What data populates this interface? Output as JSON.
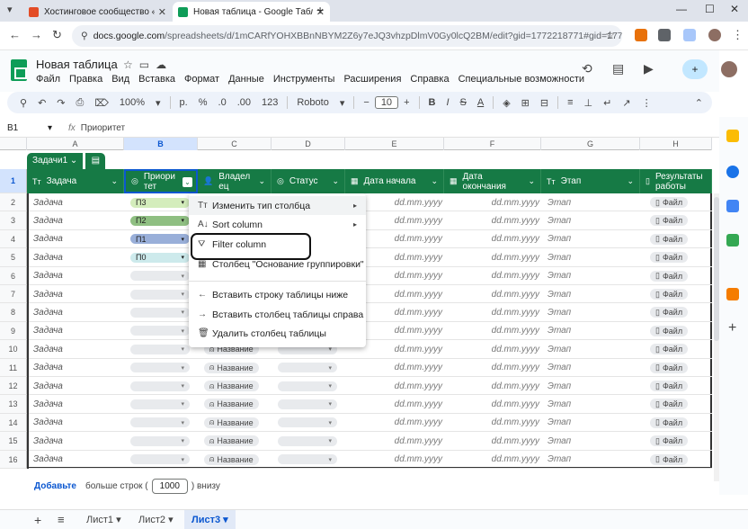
{
  "browser": {
    "tabs": [
      {
        "title": "Хостинговое сообщество «Tim",
        "active": false
      },
      {
        "title": "Новая таблица - Google Табли",
        "active": true
      }
    ],
    "url_host": "docs.google.com",
    "url_path": "/spreadsheets/d/1mCARfYOHXBBnNBYM2Z6y7eJQ3vhzpDlmV0Gy0lcQ2BM/edit?gid=1772218771#gid=1772218771"
  },
  "sheets": {
    "title": "Новая таблица",
    "menu": [
      "Файл",
      "Правка",
      "Вид",
      "Вставка",
      "Формат",
      "Данные",
      "Инструменты",
      "Расширения",
      "Справка",
      "Специальные возможности"
    ],
    "toolbar": {
      "zoom": "100%",
      "percent": "%",
      "decimals_less": ".0",
      "decimals_more": ".00",
      "format_123": "123",
      "font": "Roboto",
      "font_size": "10",
      "bold": "B",
      "italic": "I",
      "strike": "S",
      "text_color": "A"
    },
    "formula": {
      "cell": "B1",
      "value": "Приоритет"
    },
    "column_letters": [
      "A",
      "B",
      "C",
      "D",
      "E",
      "F",
      "G",
      "H"
    ],
    "table_name": "Задачи1",
    "headers": [
      {
        "icon": "Tт",
        "label": "Задача"
      },
      {
        "icon": "◎",
        "label": "Приори тет"
      },
      {
        "icon": "👤",
        "label": "Владел ец"
      },
      {
        "icon": "◎",
        "label": "Статус"
      },
      {
        "icon": "▦",
        "label": "Дата начала"
      },
      {
        "icon": "▦",
        "label": "Дата окончания"
      },
      {
        "icon": "Tт",
        "label": "Этап"
      },
      {
        "icon": "▯",
        "label": "Результаты работы"
      }
    ],
    "row_numbers": [
      "1",
      "2",
      "3",
      "4",
      "5",
      "6",
      "7",
      "8",
      "9",
      "10",
      "11",
      "12",
      "13",
      "14",
      "15",
      "16"
    ],
    "rows": [
      {
        "task": "Задача",
        "priority": "П3",
        "pcolor": "#d4edbc",
        "owner": "",
        "date_start": "dd.mm.yyyy",
        "date_end": "dd.mm.yyyy",
        "stage": "Этап",
        "file": "Файл"
      },
      {
        "task": "Задача",
        "priority": "П2",
        "pcolor": "#8fbf82",
        "owner": "",
        "date_start": "dd.mm.yyyy",
        "date_end": "dd.mm.yyyy",
        "stage": "Этап",
        "file": "Файл"
      },
      {
        "task": "Задача",
        "priority": "П1",
        "pcolor": "#99afd9",
        "owner": "",
        "date_start": "dd.mm.yyyy",
        "date_end": "dd.mm.yyyy",
        "stage": "Этап",
        "file": "Файл"
      },
      {
        "task": "Задача",
        "priority": "П0",
        "pcolor": "#cdeaec",
        "owner": "",
        "date_start": "dd.mm.yyyy",
        "date_end": "dd.mm.yyyy",
        "stage": "Этап",
        "file": "Файл"
      },
      {
        "task": "Задача",
        "priority": "",
        "pcolor": "",
        "owner": "",
        "date_start": "dd.mm.yyyy",
        "date_end": "dd.mm.yyyy",
        "stage": "Этап",
        "file": "Файл"
      },
      {
        "task": "Задача",
        "priority": "",
        "pcolor": "",
        "owner": "",
        "date_start": "dd.mm.yyyy",
        "date_end": "dd.mm.yyyy",
        "stage": "Этап",
        "file": "Файл"
      },
      {
        "task": "Задача",
        "priority": "",
        "pcolor": "",
        "owner": "",
        "date_start": "dd.mm.yyyy",
        "date_end": "dd.mm.yyyy",
        "stage": "Этап",
        "file": "Файл"
      },
      {
        "task": "Задача",
        "priority": "",
        "pcolor": "",
        "owner": "Название",
        "date_start": "dd.mm.yyyy",
        "date_end": "dd.mm.yyyy",
        "stage": "Этап",
        "file": "Файл"
      },
      {
        "task": "Задача",
        "priority": "",
        "pcolor": "",
        "owner": "Название",
        "date_start": "dd.mm.yyyy",
        "date_end": "dd.mm.yyyy",
        "stage": "Этап",
        "file": "Файл"
      },
      {
        "task": "Задача",
        "priority": "",
        "pcolor": "",
        "owner": "Название",
        "date_start": "dd.mm.yyyy",
        "date_end": "dd.mm.yyyy",
        "stage": "Этап",
        "file": "Файл"
      },
      {
        "task": "Задача",
        "priority": "",
        "pcolor": "",
        "owner": "Название",
        "date_start": "dd.mm.yyyy",
        "date_end": "dd.mm.yyyy",
        "stage": "Этап",
        "file": "Файл"
      },
      {
        "task": "Задача",
        "priority": "",
        "pcolor": "",
        "owner": "Название",
        "date_start": "dd.mm.yyyy",
        "date_end": "dd.mm.yyyy",
        "stage": "Этап",
        "file": "Файл"
      },
      {
        "task": "Задача",
        "priority": "",
        "pcolor": "",
        "owner": "Название",
        "date_start": "dd.mm.yyyy",
        "date_end": "dd.mm.yyyy",
        "stage": "Этап",
        "file": "Файл"
      },
      {
        "task": "Задача",
        "priority": "",
        "pcolor": "",
        "owner": "Название",
        "date_start": "dd.mm.yyyy",
        "date_end": "dd.mm.yyyy",
        "stage": "Этап",
        "file": "Файл"
      },
      {
        "task": "Задача",
        "priority": "",
        "pcolor": "",
        "owner": "Название",
        "date_start": "dd.mm.yyyy",
        "date_end": "dd.mm.yyyy",
        "stage": "Этап",
        "file": "Файл"
      }
    ],
    "context_menu": [
      {
        "icon": "Tт",
        "label": "Изменить тип столбца",
        "submenu": true
      },
      {
        "icon": "A↓",
        "label": "Sort column",
        "submenu": true
      },
      {
        "icon": "⛛",
        "label": "Filter column",
        "submenu": false
      },
      {
        "icon": "▦",
        "label": "Столбец \"Основание группировки\"",
        "submenu": false
      },
      {
        "icon": "←",
        "label": "Вставить строку таблицы ниже",
        "submenu": false
      },
      {
        "icon": "→",
        "label": "Вставить столбец таблицы справа",
        "submenu": false
      },
      {
        "icon": "🗑",
        "label": "Удалить столбец таблицы",
        "submenu": false
      }
    ],
    "bottom": {
      "add_label": "Добавьте",
      "more_rows_label": "больше строк (",
      "rows_value": "1000",
      "below_label": ") внизу"
    },
    "sheet_tabs": [
      {
        "label": "Лист1",
        "active": false
      },
      {
        "label": "Лист2",
        "active": false
      },
      {
        "label": "Лист3",
        "active": true
      }
    ],
    "accent_color": "#167a45",
    "selection_color": "#0b57d0"
  }
}
